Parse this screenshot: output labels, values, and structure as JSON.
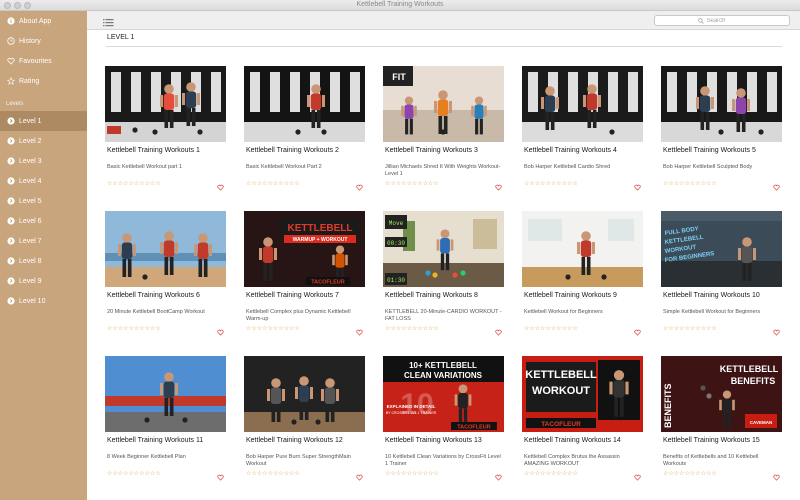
{
  "window": {
    "title": "Kettlebell Training Workouts"
  },
  "sidebar": {
    "items": [
      {
        "label": "About App",
        "icon": "info-icon"
      },
      {
        "label": "History",
        "icon": "clock-icon"
      },
      {
        "label": "Favourites",
        "icon": "heart-icon"
      },
      {
        "label": "Rating",
        "icon": "star-icon"
      }
    ],
    "section_label": "Levels",
    "levels": [
      {
        "label": "Level 1",
        "selected": true
      },
      {
        "label": "Level 2"
      },
      {
        "label": "Level 3"
      },
      {
        "label": "Level 4"
      },
      {
        "label": "Level 5"
      },
      {
        "label": "Level 6"
      },
      {
        "label": "Level 7"
      },
      {
        "label": "Level 8"
      },
      {
        "label": "Level 9"
      },
      {
        "label": "Level 10"
      }
    ]
  },
  "toolbar": {
    "search_placeholder": "Search",
    "list_icon": "list-icon"
  },
  "main": {
    "title": "LEVEL 1",
    "cards": [
      {
        "title": "Kettlebell Training Workouts 1",
        "desc": "Basic Kettlebell Workout part 1",
        "rating": "☆☆☆☆☆☆☆☆☆☆"
      },
      {
        "title": "Kettlebell Training Workouts 2",
        "desc": "Basic Kettlebell Workout Part 2",
        "rating": "☆☆☆☆☆☆☆☆☆☆"
      },
      {
        "title": "Kettlebell Training Workouts 3",
        "desc": "Jillian Michaels Shred It With Weights Workout- Level 1",
        "rating": "☆☆☆☆☆☆☆☆☆☆",
        "thumb_text": "FIT"
      },
      {
        "title": "Kettlebell Training Workouts 4",
        "desc": "Bob Harper   Kettlebell Cardio Shred",
        "rating": "☆☆☆☆☆☆☆☆☆☆"
      },
      {
        "title": "Kettlebell Training Workouts 5",
        "desc": "Bob Harper   Kettlebell Sculpted Body",
        "rating": "☆☆☆☆☆☆☆☆☆☆"
      },
      {
        "title": "Kettlebell Training Workouts 6",
        "desc": "20 Minute Kettlebell BootCamp Workout",
        "rating": "☆☆☆☆☆☆☆☆☆☆"
      },
      {
        "title": "Kettlebell Training Workouts 7",
        "desc": "Kettlebell Complex plus Dynamic Kettlebell Warm-up",
        "rating": "☆☆☆☆☆☆☆☆☆☆",
        "thumb_text": "KETTLEBELL",
        "thumb_sub": "WARMUP + WORKOUT",
        "thumb_brand": "TACOFLEUR"
      },
      {
        "title": "Kettlebell Training Workouts 8",
        "desc": "KETTLEBELL 20-Minute-CARDIO WORKOUT - FAT LOSS",
        "rating": "☆☆☆☆☆☆☆☆☆☆",
        "thumb_text": "00:30",
        "thumb_sub": "01:30"
      },
      {
        "title": "Kettlebell Training Workouts 9",
        "desc": "Kettlebell Workout for Beginners",
        "rating": "☆☆☆☆☆☆☆☆☆☆"
      },
      {
        "title": "Kettlebell Training Workouts 10",
        "desc": "Simple Kettlebell Workout for Beginners",
        "rating": "☆☆☆☆☆☆☆☆☆☆",
        "thumb_text": "FULL BODY KETTLEBELL WORKOUT FOR BEGINNERS"
      },
      {
        "title": "Kettlebell Training Workouts 11",
        "desc": "8 Week Beginner Kettlebell Plan",
        "rating": "☆☆☆☆☆☆☆☆☆☆"
      },
      {
        "title": "Kettlebell Training Workouts 12",
        "desc": "Bob Harper   Pure Burn Super StrengthMain Workout",
        "rating": "☆☆☆☆☆☆☆☆☆☆"
      },
      {
        "title": "Kettlebell Training Workouts 13",
        "desc": "10 Kettlebell Clean Variations by CrossFit Level 1 Trainer",
        "rating": "☆☆☆☆☆☆☆☆☆☆",
        "thumb_text": "10+ KETTLEBELL CLEAN VARIATIONS",
        "thumb_sub": "EXPLAINED IN DETAIL BY CROSSFIT LVL 1 TRAINER",
        "thumb_brand": "TACOFLEUR"
      },
      {
        "title": "Kettlebell Training Workouts 14",
        "desc": "Kettlebell Complex Brutus the Assassin AMAZING WORKOUT",
        "rating": "☆☆☆☆☆☆☆☆☆☆",
        "thumb_text": "KETTLEBELL WORKOUT",
        "thumb_brand": "TACOFLEUR"
      },
      {
        "title": "Kettlebell Training Workouts 15",
        "desc": "Benefits of Kettlebells and 10 Kettlebell Workouts",
        "rating": "☆☆☆☆☆☆☆☆☆☆",
        "thumb_text": "KETTLEBELL BENEFITS",
        "thumb_sub": "BENEFITS"
      }
    ]
  }
}
